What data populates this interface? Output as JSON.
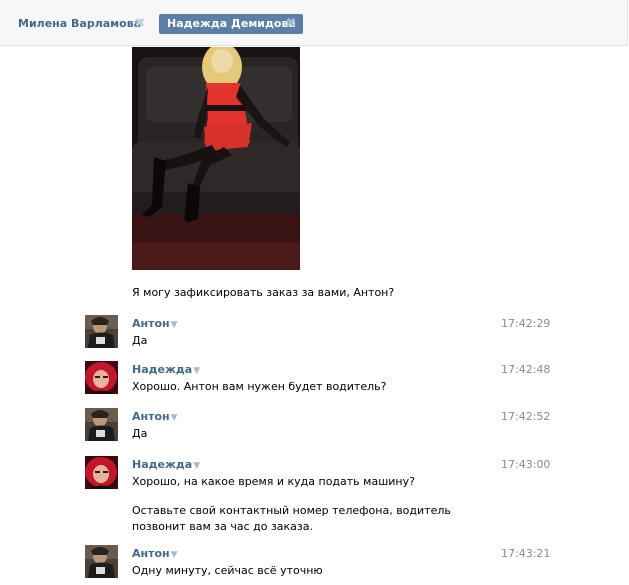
{
  "tabs": [
    {
      "label": "Милена Варламова",
      "close": "✖"
    },
    {
      "label": "Надежда Демидова",
      "close": "✖"
    }
  ],
  "system_message": "Я могу зафиксировать заказ за вами, Антон?",
  "caret": "▼",
  "messages": [
    {
      "author": "Антон",
      "time": "17:42:29",
      "text": "Да"
    },
    {
      "author": "Надежда",
      "time": "17:42:48",
      "text": "Хорошо. Антон вам нужен будет водитель?"
    },
    {
      "author": "Антон",
      "time": "17:42:52",
      "text": "Да"
    },
    {
      "author": "Надежда",
      "time": "17:43:00",
      "text": "Хорошо, на какое время и куда подать машину?",
      "text2": "Оставьте свой контактный номер телефона, водитель позвонит вам за час до заказа."
    },
    {
      "author": "Антон",
      "time": "17:43:21",
      "text": "Одну минуту, сейчас всё уточню"
    }
  ],
  "colors": {
    "link": "#45688e",
    "active_tab": "#5b7fa6",
    "time": "#8a8a8a"
  }
}
